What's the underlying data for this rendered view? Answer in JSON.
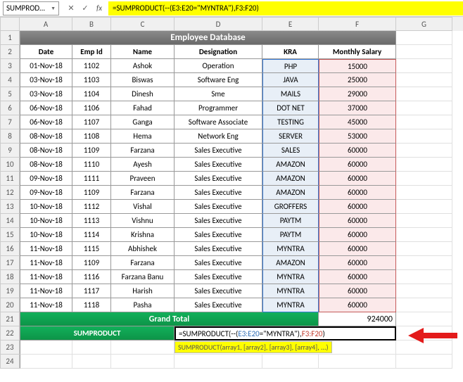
{
  "name_box": "SUMPROD...",
  "formula_bar": "=SUMPRODUCT(--(E3:E20=\"MYNTRA\"),F3:F20)",
  "columns": [
    "A",
    "B",
    "C",
    "D",
    "E",
    "F",
    "G"
  ],
  "rows": [
    "1",
    "2",
    "3",
    "4",
    "5",
    "6",
    "7",
    "8",
    "9",
    "10",
    "11",
    "12",
    "13",
    "14",
    "15",
    "16",
    "17",
    "18",
    "19",
    "20",
    "21",
    "22",
    "23",
    "24"
  ],
  "title": "Employee Database",
  "headers": {
    "A": "Date",
    "B": "Emp Id",
    "C": "Name",
    "D": "Designation",
    "E": "KRA",
    "F": "Monthly Salary"
  },
  "data": [
    {
      "A": "01-Nov-18",
      "B": "1102",
      "C": "Ashok",
      "D": "Operation",
      "E": "PHP",
      "F": "15000"
    },
    {
      "A": "03-Nov-18",
      "B": "1103",
      "C": "Biswas",
      "D": "Software Eng",
      "E": "JAVA",
      "F": "25000"
    },
    {
      "A": "03-Nov-18",
      "B": "1104",
      "C": "Dinesh",
      "D": "Sme",
      "E": "MAILS",
      "F": "29000"
    },
    {
      "A": "06-Nov-18",
      "B": "1106",
      "C": "Fahad",
      "D": "Programmer",
      "E": "DOT NET",
      "F": "37000"
    },
    {
      "A": "06-Nov-18",
      "B": "1107",
      "C": "Ganga",
      "D": "Software Associate",
      "E": "TESTING",
      "F": "45000"
    },
    {
      "A": "08-Nov-18",
      "B": "1108",
      "C": "Hema",
      "D": "Network Eng",
      "E": "SERVER",
      "F": "53000"
    },
    {
      "A": "08-Nov-18",
      "B": "1109",
      "C": "Farzana",
      "D": "Sales Executive",
      "E": "SALES",
      "F": "60000"
    },
    {
      "A": "08-Nov-18",
      "B": "1110",
      "C": "Ayesh",
      "D": "Sales Executive",
      "E": "AMAZON",
      "F": "60000"
    },
    {
      "A": "09-Nov-18",
      "B": "1111",
      "C": "Praveen",
      "D": "Sales Executive",
      "E": "AMAZON",
      "F": "60000"
    },
    {
      "A": "09-Nov-18",
      "B": "1109",
      "C": "Farzana",
      "D": "Sales Executive",
      "E": "AMAZON",
      "F": "60000"
    },
    {
      "A": "10-Nov-18",
      "B": "1112",
      "C": "Vishal",
      "D": "Sales Executive",
      "E": "GROFFERS",
      "F": "60000"
    },
    {
      "A": "10-Nov-18",
      "B": "1113",
      "C": "Vishnu",
      "D": "Sales Executive",
      "E": "PAYTM",
      "F": "60000"
    },
    {
      "A": "10-Nov-18",
      "B": "1114",
      "C": "Krishna",
      "D": "Sales Executive",
      "E": "PAYTM",
      "F": "60000"
    },
    {
      "A": "11-Nov-18",
      "B": "1115",
      "C": "Abhishek",
      "D": "Sales Executive",
      "E": "MYNTRA",
      "F": "60000"
    },
    {
      "A": "11-Nov-18",
      "B": "1109",
      "C": "Farzana",
      "D": "Sales Executive",
      "E": "AMAZON",
      "F": "60000"
    },
    {
      "A": "11-Nov-18",
      "B": "1116",
      "C": "Farzana Banu",
      "D": "Sales Executive",
      "E": "MYNTRA",
      "F": "60000"
    },
    {
      "A": "11-Nov-18",
      "B": "1117",
      "C": "Harish",
      "D": "Sales Executive",
      "E": "MYNTRA",
      "F": "60000"
    },
    {
      "A": "11-Nov-18",
      "B": "1118",
      "C": "Pasha",
      "D": "Sales Executive",
      "E": "MYNTRA",
      "F": "60000"
    }
  ],
  "grand_total_label": "Grand Total",
  "grand_total_value": "924000",
  "sumproduct_label": "SUMPRODUCT",
  "formula_cell": {
    "prefix": "=SUMPRODUCT(--(",
    "range1": "E3:E20",
    "mid": "=\"MYNTRA\"),",
    "range2": "F3:F20",
    "suffix": ")"
  },
  "tooltip": "SUMPRODUCT(array1, [array2], [array3], [array4], ...)",
  "fx_label": "fx",
  "chart_data": {
    "type": "table",
    "title": "Employee Database",
    "columns": [
      "Date",
      "Emp Id",
      "Name",
      "Designation",
      "KRA",
      "Monthly Salary"
    ],
    "rows": [
      [
        "01-Nov-18",
        1102,
        "Ashok",
        "Operation",
        "PHP",
        15000
      ],
      [
        "03-Nov-18",
        1103,
        "Biswas",
        "Software Eng",
        "JAVA",
        25000
      ],
      [
        "03-Nov-18",
        1104,
        "Dinesh",
        "Sme",
        "MAILS",
        29000
      ],
      [
        "06-Nov-18",
        1106,
        "Fahad",
        "Programmer",
        "DOT NET",
        37000
      ],
      [
        "06-Nov-18",
        1107,
        "Ganga",
        "Software Associate",
        "TESTING",
        45000
      ],
      [
        "08-Nov-18",
        1108,
        "Hema",
        "Network Eng",
        "SERVER",
        53000
      ],
      [
        "08-Nov-18",
        1109,
        "Farzana",
        "Sales Executive",
        "SALES",
        60000
      ],
      [
        "08-Nov-18",
        1110,
        "Ayesh",
        "Sales Executive",
        "AMAZON",
        60000
      ],
      [
        "09-Nov-18",
        1111,
        "Praveen",
        "Sales Executive",
        "AMAZON",
        60000
      ],
      [
        "09-Nov-18",
        1109,
        "Farzana",
        "Sales Executive",
        "AMAZON",
        60000
      ],
      [
        "10-Nov-18",
        1112,
        "Vishal",
        "Sales Executive",
        "GROFFERS",
        60000
      ],
      [
        "10-Nov-18",
        1113,
        "Vishnu",
        "Sales Executive",
        "PAYTM",
        60000
      ],
      [
        "10-Nov-18",
        1114,
        "Krishna",
        "Sales Executive",
        "PAYTM",
        60000
      ],
      [
        "11-Nov-18",
        1115,
        "Abhishek",
        "Sales Executive",
        "MYNTRA",
        60000
      ],
      [
        "11-Nov-18",
        1109,
        "Farzana",
        "Sales Executive",
        "AMAZON",
        60000
      ],
      [
        "11-Nov-18",
        1116,
        "Farzana Banu",
        "Sales Executive",
        "MYNTRA",
        60000
      ],
      [
        "11-Nov-18",
        1117,
        "Harish",
        "Sales Executive",
        "MYNTRA",
        60000
      ],
      [
        "11-Nov-18",
        1118,
        "Pasha",
        "Sales Executive",
        "MYNTRA",
        60000
      ]
    ],
    "grand_total": 924000
  }
}
